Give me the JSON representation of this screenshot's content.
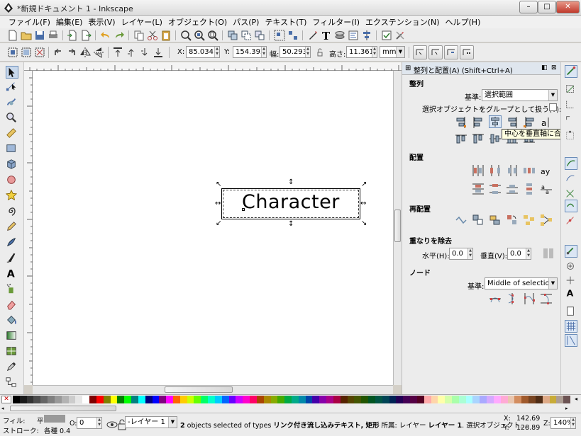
{
  "window": {
    "title": "*新規ドキュメント 1 - Inkscape",
    "min": "–",
    "max": "□",
    "close": "✕"
  },
  "menu": [
    "ファイル(F)",
    "編集(E)",
    "表示(V)",
    "レイヤー(L)",
    "オブジェクト(O)",
    "パス(P)",
    "テキスト(T)",
    "フィルター(I)",
    "エクステンション(N)",
    "ヘルプ(H)"
  ],
  "controls": {
    "x_label": "X:",
    "x_value": "85.034",
    "y_label": "Y:",
    "y_value": "154.392",
    "w_label": "幅:",
    "w_value": "50.293",
    "h_label": "高さ:",
    "h_value": "11.361",
    "unit": "mm"
  },
  "canvas": {
    "text": "Character"
  },
  "panel": {
    "title": "整列と配置(A) (Shift+Ctrl+A)",
    "align_heading": "整列",
    "relative_label": "基準:",
    "relative_value": "選択範囲",
    "group_checkbox_label": "選択オブジェクトをグループとして扱う(T):",
    "distribute_heading": "配置",
    "rearrange_heading": "再配置",
    "overlap_heading": "重なりを除去",
    "h_gap_label": "水平(H):",
    "h_gap_value": "0.0",
    "v_gap_label": "垂直(V):",
    "v_gap_value": "0.0",
    "nodes_heading": "ノード",
    "nodes_relative_label": "基準:",
    "nodes_relative_value": "Middle of selection"
  },
  "tooltip": "中心を垂直軸に合わせる",
  "status": {
    "fill_label": "フィル:",
    "fill_value": "平",
    "stroke_label": "ストローク:",
    "stroke_value": "各種 0.4",
    "opacity_label": "O:",
    "opacity_value": "0",
    "layer_value": "-レイヤー 1",
    "message_count": "2",
    "message_1": " objects selected of types ",
    "message_types": "リンク付き流し込みテキスト, 矩形",
    "message_2": " 所属: レイヤー ",
    "message_layer": "レイヤー 1",
    "message_3": ". 選択オブジェクト...",
    "x_label": "X:",
    "x_value": "142.69",
    "y_label": "Y:",
    "y_value": "128.89",
    "zoom_label": "Z:",
    "zoom_value": "140%"
  },
  "palette": [
    "#000000",
    "#1a1a1a",
    "#333333",
    "#4d4d4d",
    "#666666",
    "#808080",
    "#999999",
    "#b3b3b3",
    "#cccccc",
    "#e6e6e6",
    "#ffffff",
    "#800000",
    "#ff0000",
    "#808000",
    "#ffff00",
    "#008000",
    "#00ff00",
    "#008080",
    "#00ffff",
    "#000080",
    "#0000ff",
    "#800080",
    "#ff00ff",
    "#ff6600",
    "#ffcc00",
    "#ccff00",
    "#66ff00",
    "#00ff66",
    "#00ffcc",
    "#00ccff",
    "#0066ff",
    "#6600ff",
    "#cc00ff",
    "#ff00cc",
    "#ff0066",
    "#aa4400",
    "#aa8800",
    "#88aa00",
    "#44aa00",
    "#00aa44",
    "#00aa88",
    "#0088aa",
    "#0044aa",
    "#4400aa",
    "#8800aa",
    "#aa0088",
    "#aa0044",
    "#552200",
    "#554400",
    "#445500",
    "#225500",
    "#005522",
    "#005544",
    "#004455",
    "#002255",
    "#220055",
    "#440055",
    "#550044",
    "#550022",
    "#ffaaaa",
    "#ffd5aa",
    "#ffffaa",
    "#d5ffaa",
    "#aaffaa",
    "#aaffd5",
    "#aaffff",
    "#aad5ff",
    "#aaaaff",
    "#d5aaff",
    "#ffaaff",
    "#ffaad5",
    "#e9c6af",
    "#d38d5f",
    "#a05a2c",
    "#784421",
    "#502d16",
    "#deaa87",
    "#c8ab37",
    "#ac9d93",
    "#6c5353"
  ]
}
